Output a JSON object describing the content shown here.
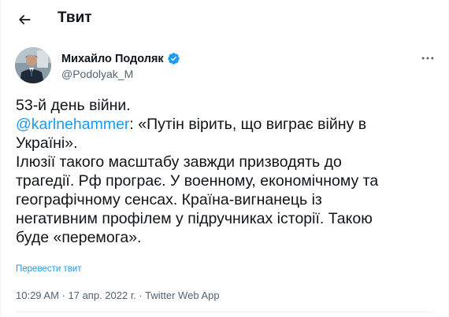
{
  "header": {
    "back_icon": "arrow-left-icon",
    "title": "Твит"
  },
  "author": {
    "name": "Михайло Подоляк",
    "handle": "@Podolyak_M",
    "verified_icon": "verified-badge-icon",
    "verified_color": "#1d9bf0",
    "more_icon": "more-horizontal-icon"
  },
  "tweet": {
    "line1": "53-й день війни.",
    "mention": "@karlnehammer",
    "line2_rest": ": «Путін вірить, що виграє війну в",
    "line3": "Україні».",
    "line4": "Ілюзії такого масштабу завжди призводять до",
    "line5": "трагедії. Рф програє. У военному, економічному та",
    "line6": "географічному сенсах. Країна-вигнанець із",
    "line7": "негативним профілем у підручниках історії. Такою",
    "line8": "буде «перемога».",
    "translate_label": "Перевести твит"
  },
  "meta": {
    "time": "10:29 AM",
    "separator": " · ",
    "date": "17 апр. 2022 г.",
    "source": "Twitter Web App"
  },
  "colors": {
    "accent": "#1d9bf0",
    "text": "#0f1419",
    "secondary": "#536471"
  }
}
